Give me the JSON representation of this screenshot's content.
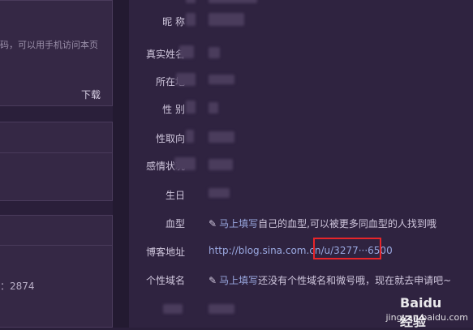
{
  "left": {
    "app_desc": "码，可以用手机访问本页",
    "download_label": "下载",
    "stat_text": "：2874"
  },
  "profile": {
    "rows": [
      {
        "label": "昵 称",
        "value": ""
      },
      {
        "label": "真实姓名",
        "value": ""
      },
      {
        "label": "所在地",
        "value": ""
      },
      {
        "label": "性 别",
        "value": ""
      },
      {
        "label": "性取向",
        "value": ""
      },
      {
        "label": "感情状况",
        "value": ""
      },
      {
        "label": "生日",
        "value": ""
      },
      {
        "label": "血型",
        "value_link": "马上填写",
        "value_text": "自己的血型,可以被更多同血型的人找到哦"
      },
      {
        "label": "博客地址",
        "value": "http://blog.sina.com.cn/u/3277···6500"
      },
      {
        "label": "个性域名",
        "value_link": "马上填写",
        "value_text": "还没有个性域名和微号哦，现在就去申请吧~"
      }
    ]
  },
  "watermark": {
    "brand": "Baidu 经验",
    "url": "jingyan.baidu.com"
  },
  "colors": {
    "highlight": "#e8252a",
    "link": "#9aa8e0",
    "panel_bg": "#2f2340"
  }
}
